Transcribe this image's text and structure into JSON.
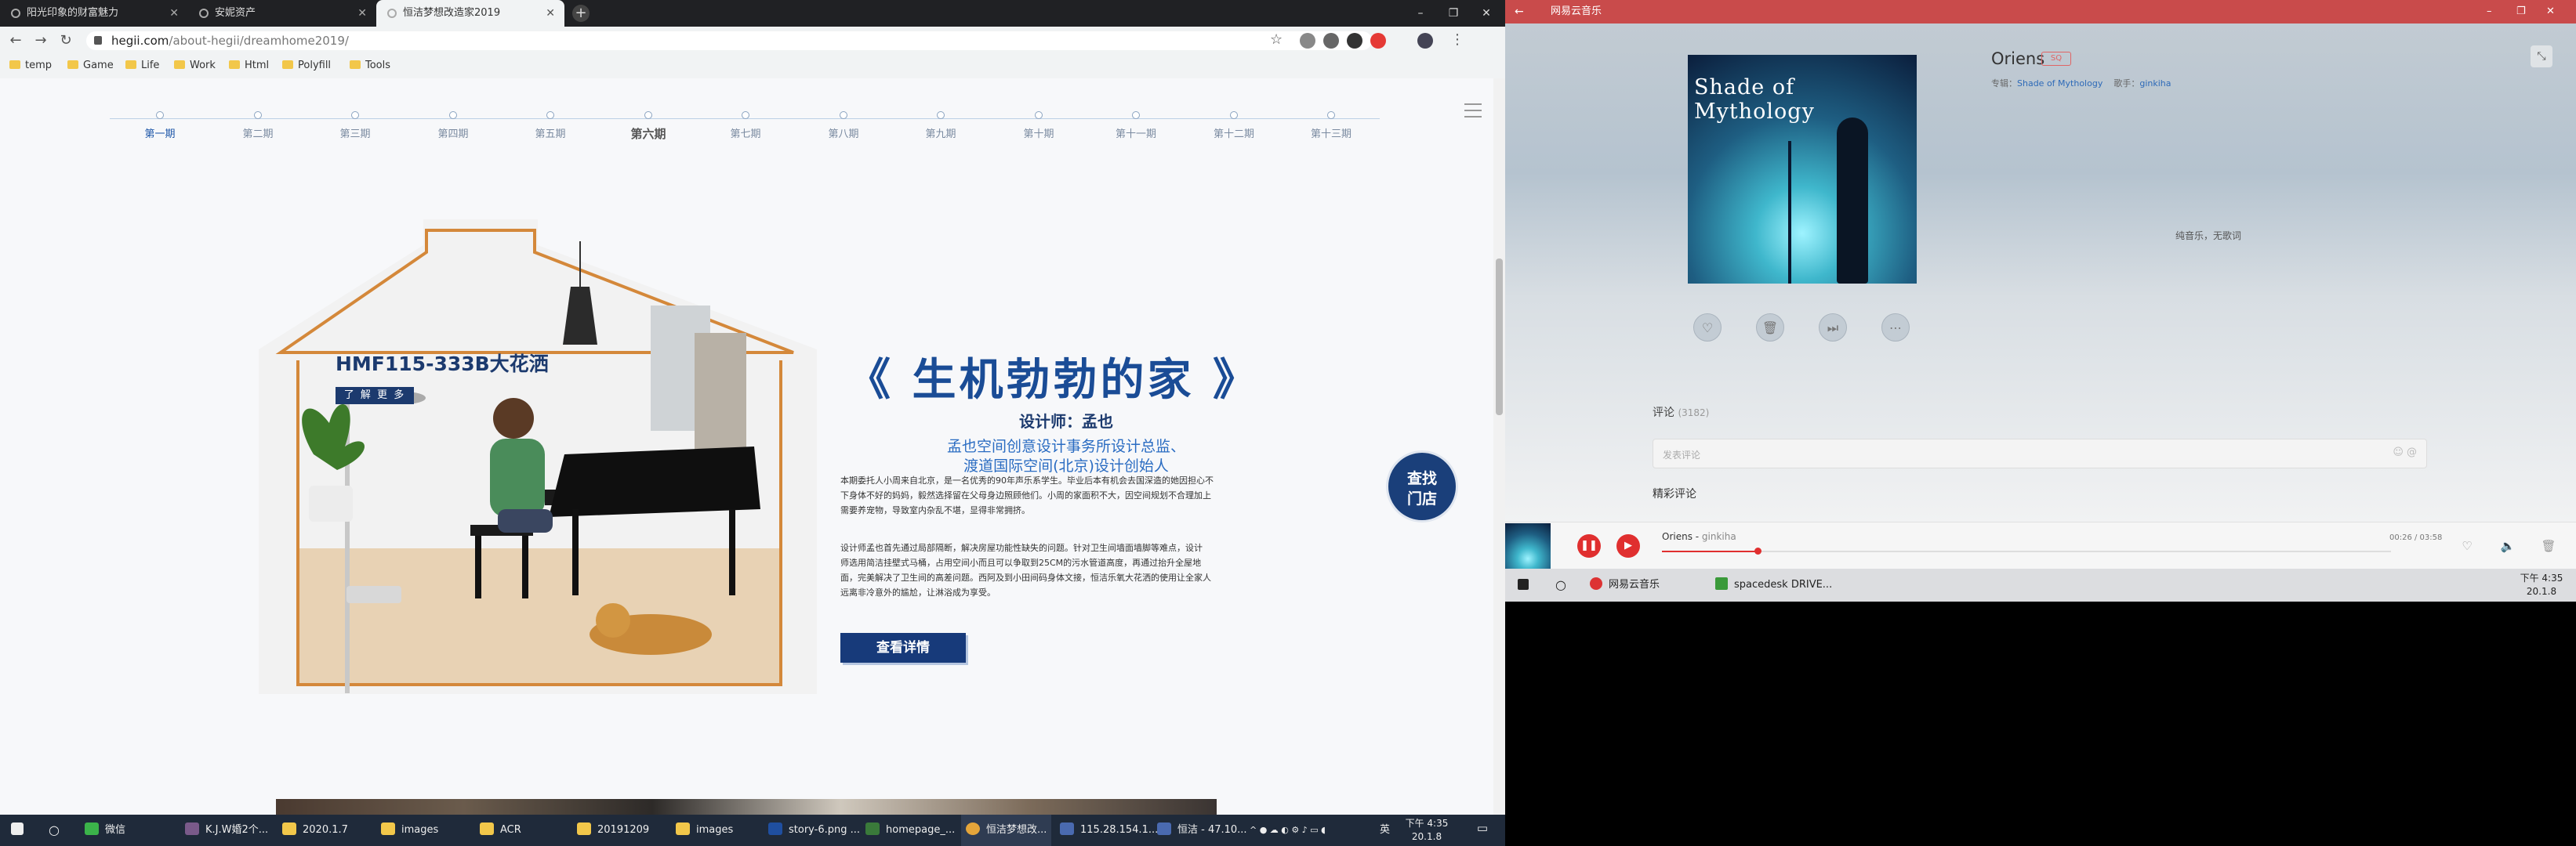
{
  "browser": {
    "tabs": [
      {
        "title": "阳光印象的财富魅力"
      },
      {
        "title": "安妮资产"
      },
      {
        "title": "恒洁梦想改造家2019",
        "active": true
      }
    ],
    "new_tab": "+",
    "window_controls": [
      "–",
      "❐",
      "✕"
    ],
    "url_host": "hegii.com",
    "url_path": "/about-hegii/dreamhome2019/",
    "bookmarks": [
      "temp",
      "Game",
      "Life",
      "Work",
      "Html",
      "Polyfill",
      "Tools"
    ]
  },
  "page": {
    "timeline": [
      "第一期",
      "第二期",
      "第三期",
      "第四期",
      "第五期",
      "第六期",
      "第七期",
      "第八期",
      "第九期",
      "第十期",
      "第十一期",
      "第十二期",
      "第十三期"
    ],
    "active_period": "第一期",
    "current_period": "第六期",
    "product_title": "HMF115-333B大花洒",
    "learn_more": "了 解 更 多",
    "headline": "《 生机勃勃的家 》",
    "designer": "设计师：孟也",
    "designer_sub1": "孟也空间创意设计事务所设计总监、",
    "designer_sub2": "渡道国际空间(北京)设计创始人",
    "para1": [
      "本期委托人小周来自北京，是一名优秀的90年声乐系学生。毕业后本有机会去国深造的她因担心不",
      "下身体不好的妈妈，毅然选择留在父母身边照顾他们。小周的家面积不大，因空间规划不合理加上",
      "需要养宠物，导致室内杂乱不堪，显得非常拥挤。"
    ],
    "para2": [
      "设计师孟也首先通过局部隔断，解决房屋功能性缺失的问题。针对卫生间墙面墙脚等难点，设计",
      "师选用简洁挂壁式马桶，占用空间小而且可以争取到25CM的污水管道高度，再通过抬升全屋地",
      "面，完美解决了卫生间的高差问题。西阿及到小田间码身体文接，恒洁乐氧大花洒的使用让全家人",
      "远离非冷意外的尴尬，让淋浴成为享受。"
    ],
    "detail_button": "查看详情",
    "store_button_line1": "查找",
    "store_button_line2": "门店"
  },
  "taskbar_left": {
    "items": [
      "微信",
      "K.J.W婚2个...",
      "2020.1.7",
      "images",
      "ACR",
      "20191209",
      "images",
      "story-6.png ...",
      "homepage_...",
      "恒洁梦想改...",
      "115.28.154.1...",
      "恒洁 - 47.10..."
    ],
    "tray": "英",
    "time": "下午 4:35",
    "date": "20.1.8"
  },
  "music": {
    "app_title": "网易云音乐",
    "song": "Oriens",
    "song_tag": "SQ",
    "album_label": "专辑：",
    "album": "Shade of Mythology",
    "artist_label": "歌手：",
    "artist": "ginkiha",
    "cover_text": "Shade of Mythology",
    "lyric": "纯音乐，无歌词",
    "comments_label": "评论",
    "comments_count": "(3182)",
    "comment_placeholder": "发表评论",
    "hot_comments": "精彩评论",
    "player_song": "Oriens",
    "player_artist": "ginkiha",
    "player_time": "00:26 / 03:58",
    "progress": 0.131,
    "accent": "#e02f2f"
  },
  "taskbar_right": {
    "items": [
      "网易云音乐",
      "spacedesk DRIVE..."
    ],
    "time": "下午 4:35",
    "date": "20.1.8"
  }
}
